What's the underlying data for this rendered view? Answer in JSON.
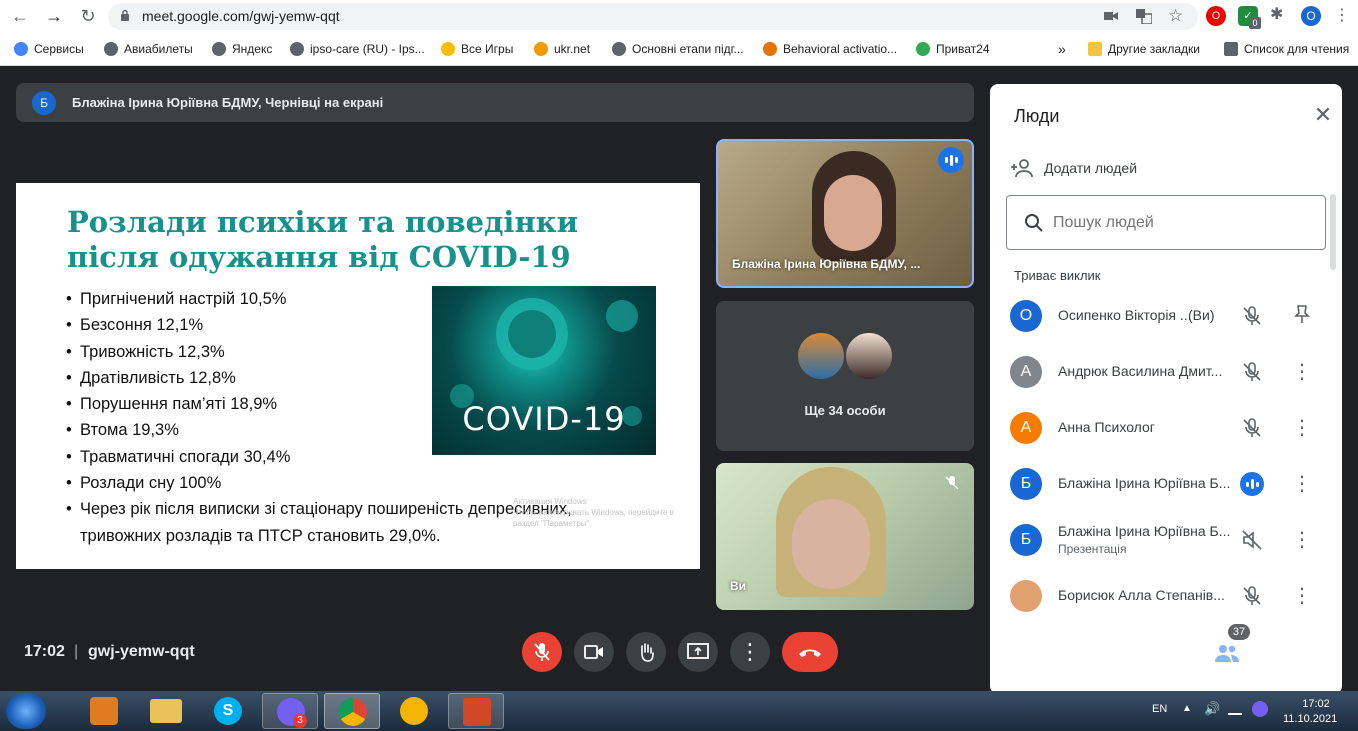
{
  "browser": {
    "url": "meet.google.com/gwj-yemw-qqt",
    "profile_initial": "O",
    "extension_badge": "0",
    "bookmarks": [
      {
        "label": "Сервисы",
        "color": "#4285f4"
      },
      {
        "label": "Авиабилеты",
        "color": "#5f6368"
      },
      {
        "label": "Яндекс",
        "color": "#5f6368"
      },
      {
        "label": "ipso-care (RU) - Ips...",
        "color": "#5f6368"
      },
      {
        "label": "Все Игры",
        "color": "#fbbc04"
      },
      {
        "label": "ukr.net",
        "color": "#f29900"
      },
      {
        "label": "Основні етапи підг...",
        "color": "#5f6368"
      },
      {
        "label": "Behavioral activatio...",
        "color": "#e37400"
      },
      {
        "label": "Приват24",
        "color": "#34a853"
      }
    ],
    "more_bookmarks": "»",
    "other_bookmarks": "Другие закладки",
    "reading_list": "Список для чтения"
  },
  "banner": {
    "avatar": "Б",
    "text": "Блажіна Ірина Юріївна БДМУ, Чернівці на екрані"
  },
  "slide": {
    "title_line1": "Розлади психіки та поведінки",
    "title_line2": "після одужання від COVID-19",
    "bullets": [
      "Пригнічений настрій 10,5%",
      "Безсоння 12,1%",
      "Тривожність 12,3%",
      "Дратівливість 12,8%",
      "Порушення пам’яті 18,9%",
      "Втома 19,3%",
      "Травматичні спогади 30,4%",
      "Розлади сну 100%",
      "Через рік після виписки зі стаціонару поширеність депресивних,",
      "тривожних розладів та ПТСР становить 29,0%."
    ],
    "image_label": "COVID-19",
    "watermark_line1": "Активация Windows",
    "watermark_line2": "Чтобы активировать Windows, перейдите в",
    "watermark_line3": "раздел \"Параметры\"."
  },
  "tiles": {
    "main_speaker": "Блажіна Ірина Юріївна БДМУ, ...",
    "others": "Ще 34 особи",
    "self": "Ви"
  },
  "panel": {
    "title": "Люди",
    "add_people": "Додати людей",
    "search_placeholder": "Пошук людей",
    "section": "Триває виклик",
    "participants": [
      {
        "initial": "О",
        "color": "#1967d2",
        "name": "Осипенко Вікторія ...",
        "suffix": "(Ви)",
        "sub": ""
      },
      {
        "initial": "А",
        "color": "#80868b",
        "name": "Андрюк Василина Дмит...",
        "suffix": "",
        "sub": ""
      },
      {
        "initial": "А",
        "color": "#f57c00",
        "name": "Анна Психолог",
        "suffix": "",
        "sub": ""
      },
      {
        "initial": "Б",
        "color": "#1967d2",
        "name": "Блажіна Ірина Юріївна Б...",
        "suffix": "",
        "sub": ""
      },
      {
        "initial": "Б",
        "color": "#1967d2",
        "name": "Блажіна Ірина Юріївна Б...",
        "suffix": "",
        "sub": "Презентація"
      },
      {
        "initial": "",
        "color": "#e0a070",
        "name": "Борисюк Алла Степанів...",
        "suffix": "",
        "sub": ""
      }
    ]
  },
  "bottom": {
    "time": "17:02",
    "separator": "|",
    "meeting_code": "gwj-yemw-qqt",
    "participants_count": "37"
  },
  "taskbar": {
    "lang": "EN",
    "time": "17:02",
    "date": "11.10.2021",
    "viber_badge": "3"
  }
}
